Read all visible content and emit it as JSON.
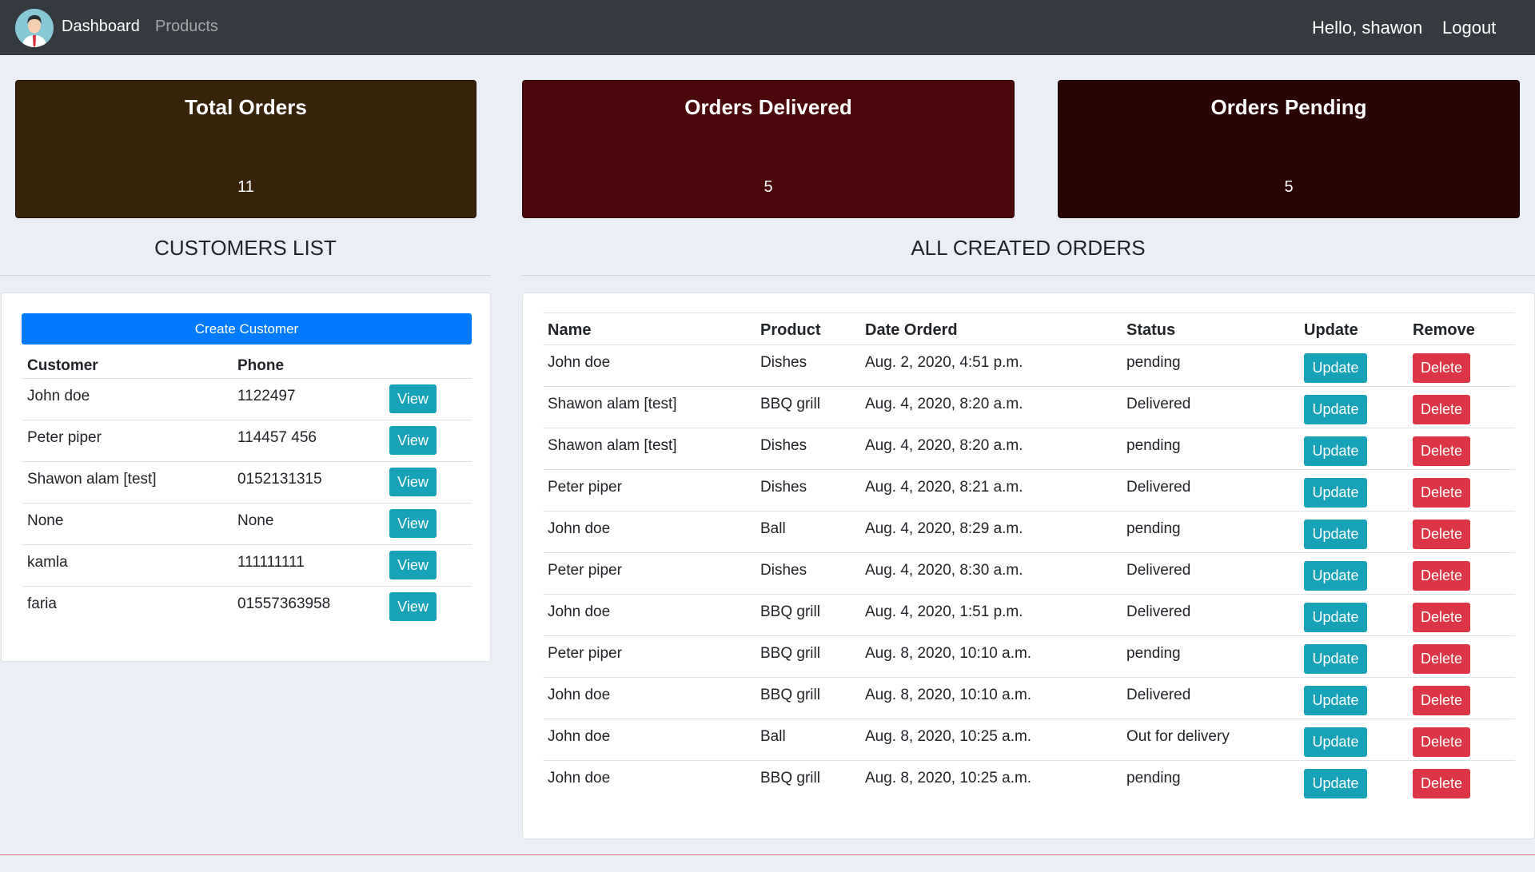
{
  "navbar": {
    "dashboard_label": "Dashboard",
    "products_label": "Products",
    "greeting": "Hello, shawon",
    "logout_label": "Logout"
  },
  "stats": {
    "total_orders": {
      "title": "Total Orders",
      "value": "11",
      "color": "#37220a"
    },
    "orders_delivered": {
      "title": "Orders Delivered",
      "value": "5",
      "color": "#4a080b"
    },
    "orders_pending": {
      "title": "Orders Pending",
      "value": "5",
      "color": "#2a0506"
    }
  },
  "customers": {
    "heading": "CUSTOMERS LIST",
    "create_label": "Create Customer",
    "columns": [
      "Customer",
      "Phone"
    ],
    "view_label": "View",
    "rows": [
      {
        "name": "John doe",
        "phone": "1122497"
      },
      {
        "name": "Peter piper",
        "phone": "114457 456"
      },
      {
        "name": "Shawon alam [test]",
        "phone": "0152131315"
      },
      {
        "name": "None",
        "phone": "None"
      },
      {
        "name": "kamla",
        "phone": "111111111"
      },
      {
        "name": "faria",
        "phone": "01557363958"
      }
    ]
  },
  "orders": {
    "heading": "ALL CREATED ORDERS",
    "columns": [
      "Name",
      "Product",
      "Date Orderd",
      "Status",
      "Update",
      "Remove"
    ],
    "update_label": "Update",
    "delete_label": "Delete",
    "rows": [
      {
        "name": "John doe",
        "product": "Dishes",
        "date": "Aug. 2, 2020, 4:51 p.m.",
        "status": "pending"
      },
      {
        "name": "Shawon alam [test]",
        "product": "BBQ grill",
        "date": "Aug. 4, 2020, 8:20 a.m.",
        "status": "Delivered"
      },
      {
        "name": "Shawon alam [test]",
        "product": "Dishes",
        "date": "Aug. 4, 2020, 8:20 a.m.",
        "status": "pending"
      },
      {
        "name": "Peter piper",
        "product": "Dishes",
        "date": "Aug. 4, 2020, 8:21 a.m.",
        "status": "Delivered"
      },
      {
        "name": "John doe",
        "product": "Ball",
        "date": "Aug. 4, 2020, 8:29 a.m.",
        "status": "pending"
      },
      {
        "name": "Peter piper",
        "product": "Dishes",
        "date": "Aug. 4, 2020, 8:30 a.m.",
        "status": "Delivered"
      },
      {
        "name": "John doe",
        "product": "BBQ grill",
        "date": "Aug. 4, 2020, 1:51 p.m.",
        "status": "Delivered"
      },
      {
        "name": "Peter piper",
        "product": "BBQ grill",
        "date": "Aug. 8, 2020, 10:10 a.m.",
        "status": "pending"
      },
      {
        "name": "John doe",
        "product": "BBQ grill",
        "date": "Aug. 8, 2020, 10:10 a.m.",
        "status": "Delivered"
      },
      {
        "name": "John doe",
        "product": "Ball",
        "date": "Aug. 8, 2020, 10:25 a.m.",
        "status": "Out for delivery"
      },
      {
        "name": "John doe",
        "product": "BBQ grill",
        "date": "Aug. 8, 2020, 10:25 a.m.",
        "status": "pending"
      }
    ]
  },
  "colors": {
    "navbar": "#343a40",
    "primary": "#007bff",
    "info": "#17a2b8",
    "danger": "#dc3545"
  }
}
